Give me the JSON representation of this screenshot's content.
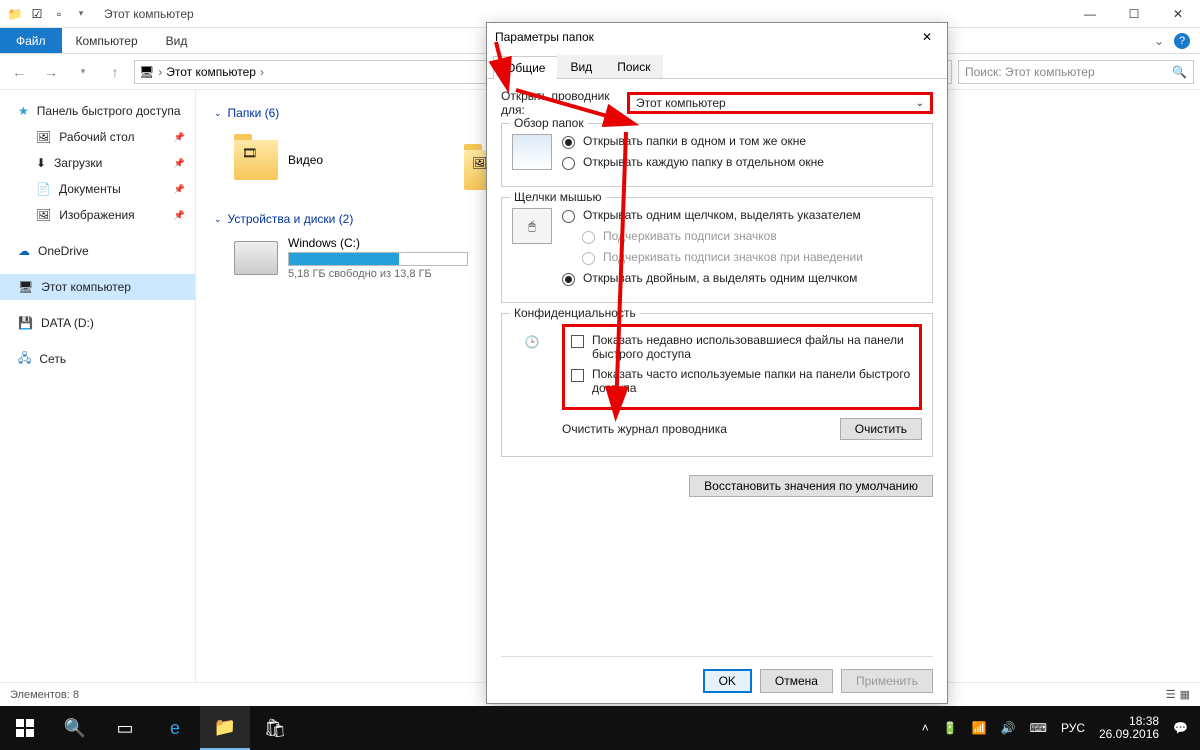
{
  "titlebar": {
    "title": "Этот компьютер"
  },
  "ribbon": {
    "file": "Файл",
    "tab_computer": "Компьютер",
    "tab_view": "Вид"
  },
  "nav": {
    "breadcrumb_root": "Этот компьютер",
    "search_placeholder": "Поиск: Этот компьютер"
  },
  "sidebar": {
    "quick_access": "Панель быстрого доступа",
    "desktop": "Рабочий стол",
    "downloads": "Загрузки",
    "documents": "Документы",
    "pictures": "Изображения",
    "onedrive": "OneDrive",
    "this_pc": "Этот компьютер",
    "data": "DATA (D:)",
    "network": "Сеть"
  },
  "content": {
    "folders_header": "Папки (6)",
    "devices_header": "Устройства и диски (2)",
    "video": "Видео",
    "pictures": "Изображения",
    "drive_c": "Windows (C:)",
    "drive_c_free": "5,18 ГБ свободно из 13,8 ГБ",
    "drive_c_fill_pct": 62
  },
  "statusbar": {
    "items": "Элементов: 8"
  },
  "dialog": {
    "title": "Параметры папок",
    "tab_general": "Общие",
    "tab_view": "Вид",
    "tab_search": "Поиск",
    "open_for_label": "Открыть проводник для:",
    "open_for_value": "Этот компьютер",
    "browse_group": "Обзор папок",
    "browse_same": "Открывать папки в одном и том же окне",
    "browse_new": "Открывать каждую папку в отдельном окне",
    "clicks_group": "Щелчки мышью",
    "click_single": "Открывать одним щелчком, выделять указателем",
    "click_underline_always": "Подчеркивать подписи значков",
    "click_underline_hover": "Подчеркивать подписи значков при наведении",
    "click_double": "Открывать двойным, а выделять одним щелчком",
    "privacy_group": "Конфиденциальность",
    "privacy_files": "Показать недавно использовавшиеся файлы на панели быстрого доступа",
    "privacy_folders": "Показать часто используемые папки на панели быстрого доступа",
    "clear_history": "Очистить журнал проводника",
    "clear_btn": "Очистить",
    "restore_btn": "Восстановить значения по умолчанию",
    "ok": "OK",
    "cancel": "Отмена",
    "apply": "Применить"
  },
  "taskbar": {
    "time": "18:38",
    "date": "26.09.2016",
    "lang": "РУС"
  }
}
